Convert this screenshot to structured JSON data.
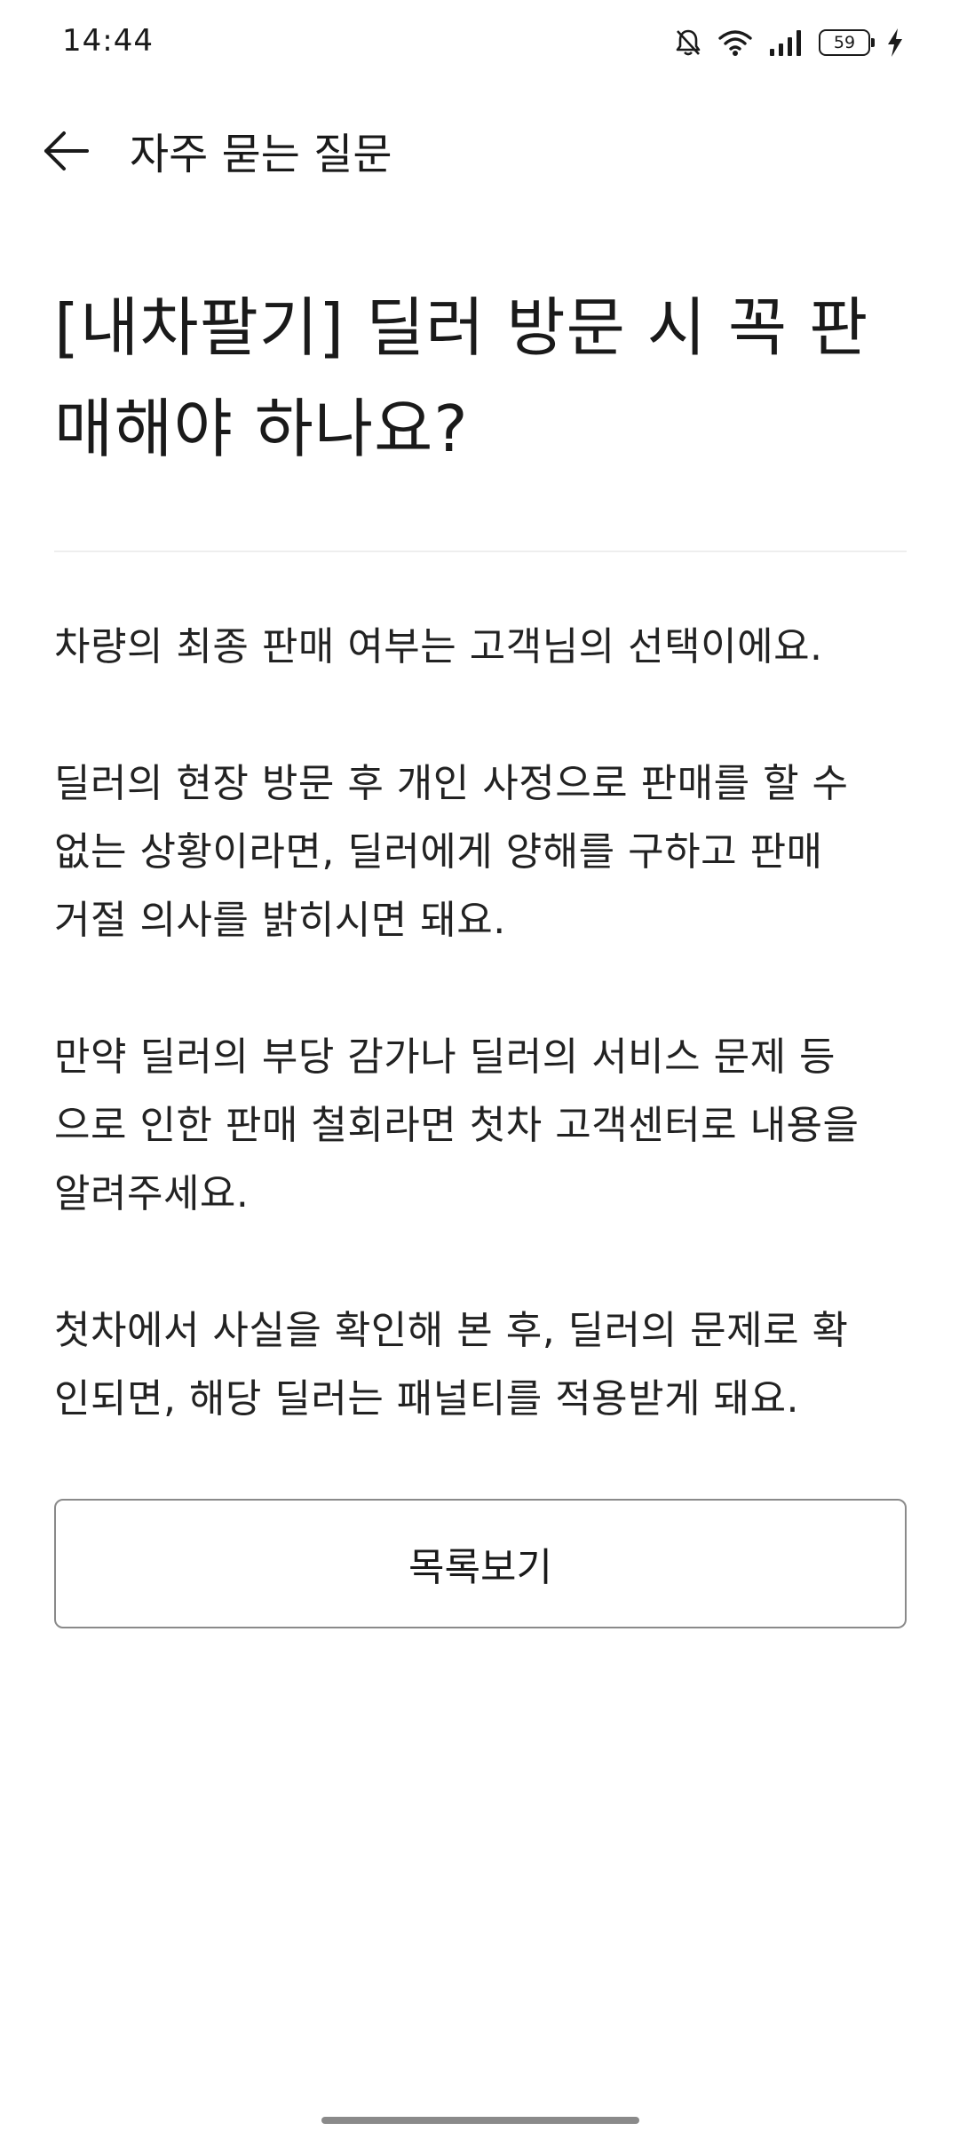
{
  "status_bar": {
    "time": "14:44",
    "battery_level": "59",
    "icons": [
      "bell-off-icon",
      "wifi-icon",
      "signal-icon",
      "battery-icon",
      "charging-icon"
    ]
  },
  "app_bar": {
    "title": "자주 묻는 질문",
    "back_icon": "arrow-left-icon"
  },
  "article": {
    "title_line1": "[내차팔기] 딜러 방문 시 꼭 판",
    "title_line2": "매해야 하나요?",
    "paragraphs": [
      {
        "lines": [
          "차량의 최종 판매 여부는 고객님의 선택이에요."
        ]
      },
      {
        "lines": [
          "딜러의 현장 방문 후 개인 사정으로 판매를 할 수",
          "없는 상황이라면, 딜러에게 양해를 구하고 판매",
          "거절 의사를 밝히시면 돼요."
        ]
      },
      {
        "lines": [
          "만약 딜러의 부당 감가나 딜러의 서비스 문제 등",
          "으로 인한 판매 철회라면 첫차 고객센터로 내용을",
          "알려주세요."
        ]
      },
      {
        "lines": [
          "첫차에서 사실을 확인해 본 후, 딜러의 문제로 확",
          "인되면, 해당 딜러는 패널티를 적용받게 돼요."
        ]
      }
    ]
  },
  "actions": {
    "list_button_label": "목록보기"
  },
  "colors": {
    "text": "#1a1a1a",
    "divider": "#eeeeee",
    "button_border": "#8a8a8a",
    "background": "#ffffff"
  }
}
